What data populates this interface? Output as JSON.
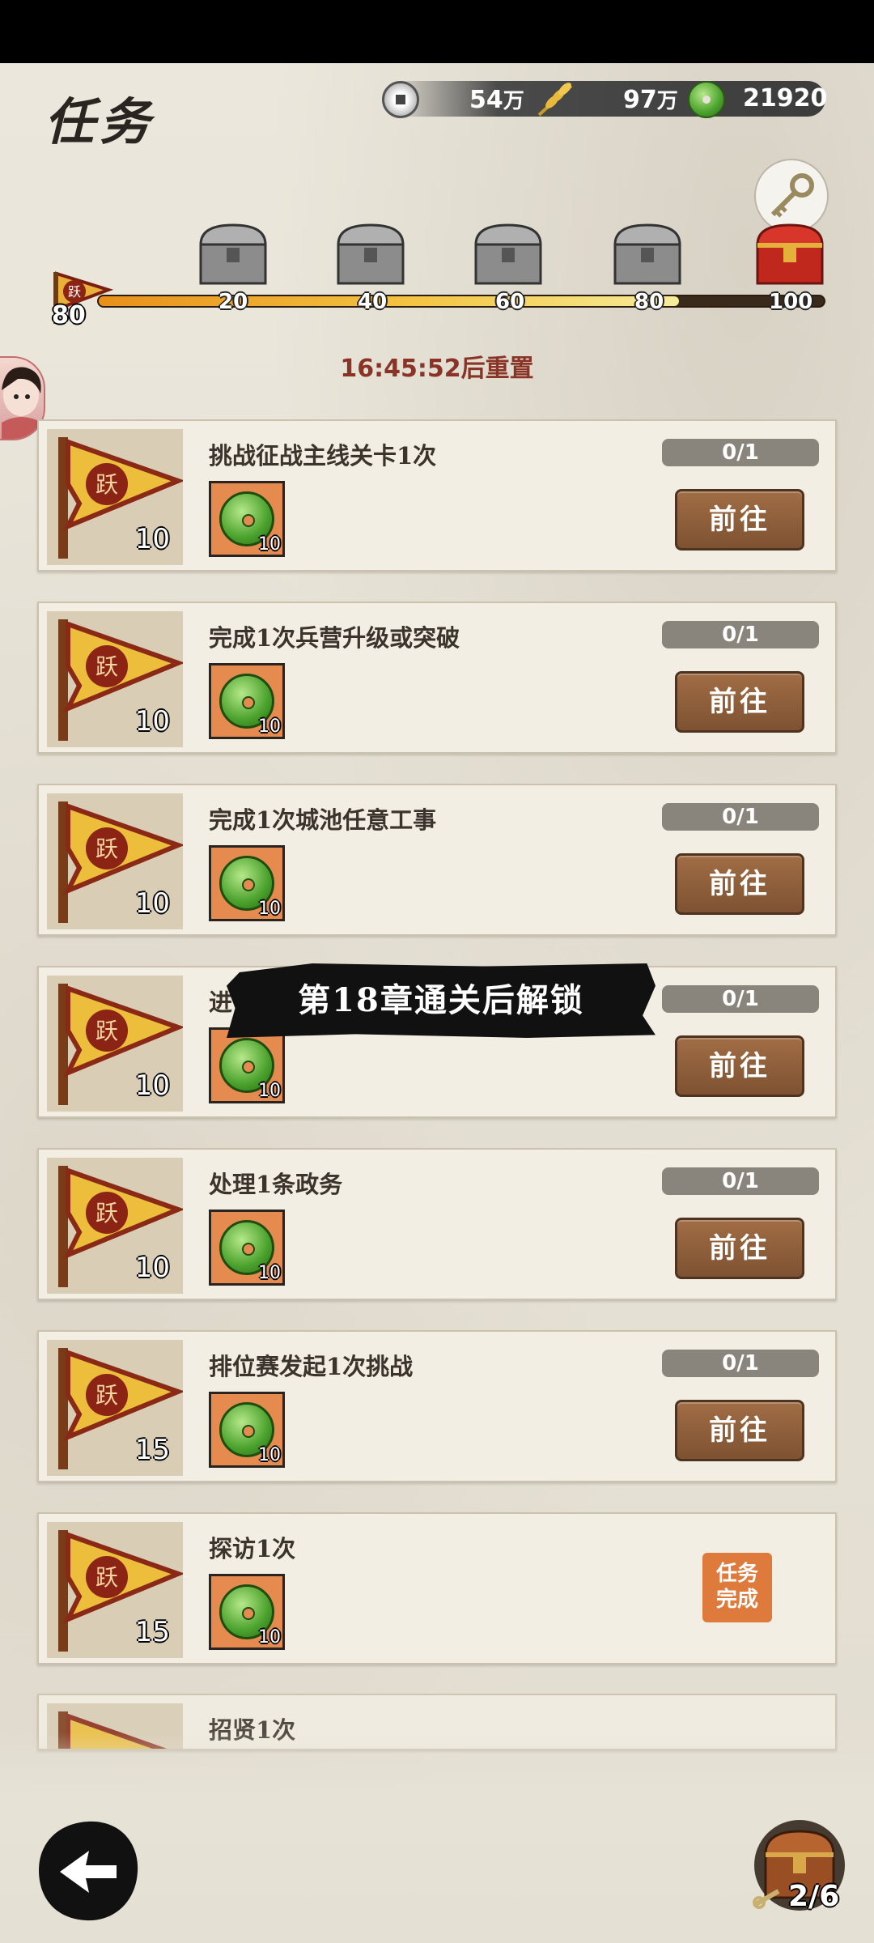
{
  "header": {
    "title": "任务",
    "resources": {
      "copper": {
        "value": "54",
        "unit": "万"
      },
      "grain": {
        "value": "97",
        "unit": "万"
      },
      "jade": {
        "value": "21920"
      }
    }
  },
  "activity": {
    "level": "80",
    "progress": 0.8,
    "milestones": [
      "20",
      "40",
      "60",
      "80",
      "100"
    ],
    "reset_text": "16:45:52后重置"
  },
  "tasks": [
    {
      "title": "挑战征战主线关卡1次",
      "flag_value": "10",
      "reward_qty": "10",
      "progress": "0/1",
      "action": "前往"
    },
    {
      "title": "完成1次兵营升级或突破",
      "flag_value": "10",
      "reward_qty": "10",
      "progress": "0/1",
      "action": "前往"
    },
    {
      "title": "完成1次城池任意工事",
      "flag_value": "10",
      "reward_qty": "10",
      "progress": "0/1",
      "action": "前往"
    },
    {
      "title": "进",
      "flag_value": "10",
      "reward_qty": "10",
      "progress": "0/1",
      "action": "前往"
    },
    {
      "title": "处理1条政务",
      "flag_value": "10",
      "reward_qty": "10",
      "progress": "0/1",
      "action": "前往"
    },
    {
      "title": "排位赛发起1次挑战",
      "flag_value": "15",
      "reward_qty": "10",
      "progress": "0/1",
      "action": "前往"
    },
    {
      "title": "探访1次",
      "flag_value": "15",
      "reward_qty": "10",
      "status": "任务完成"
    },
    {
      "title": "招贤1次"
    }
  ],
  "flag_char": "跃",
  "lock_banner": "第18章通关后解锁",
  "done_line1": "任务",
  "done_line2": "完成",
  "bottom": {
    "chest_count": "2/6"
  },
  "colors": {
    "accent_brown": "#7e5232",
    "reset_red": "#8a3428",
    "done_orange": "#de7b3c"
  }
}
